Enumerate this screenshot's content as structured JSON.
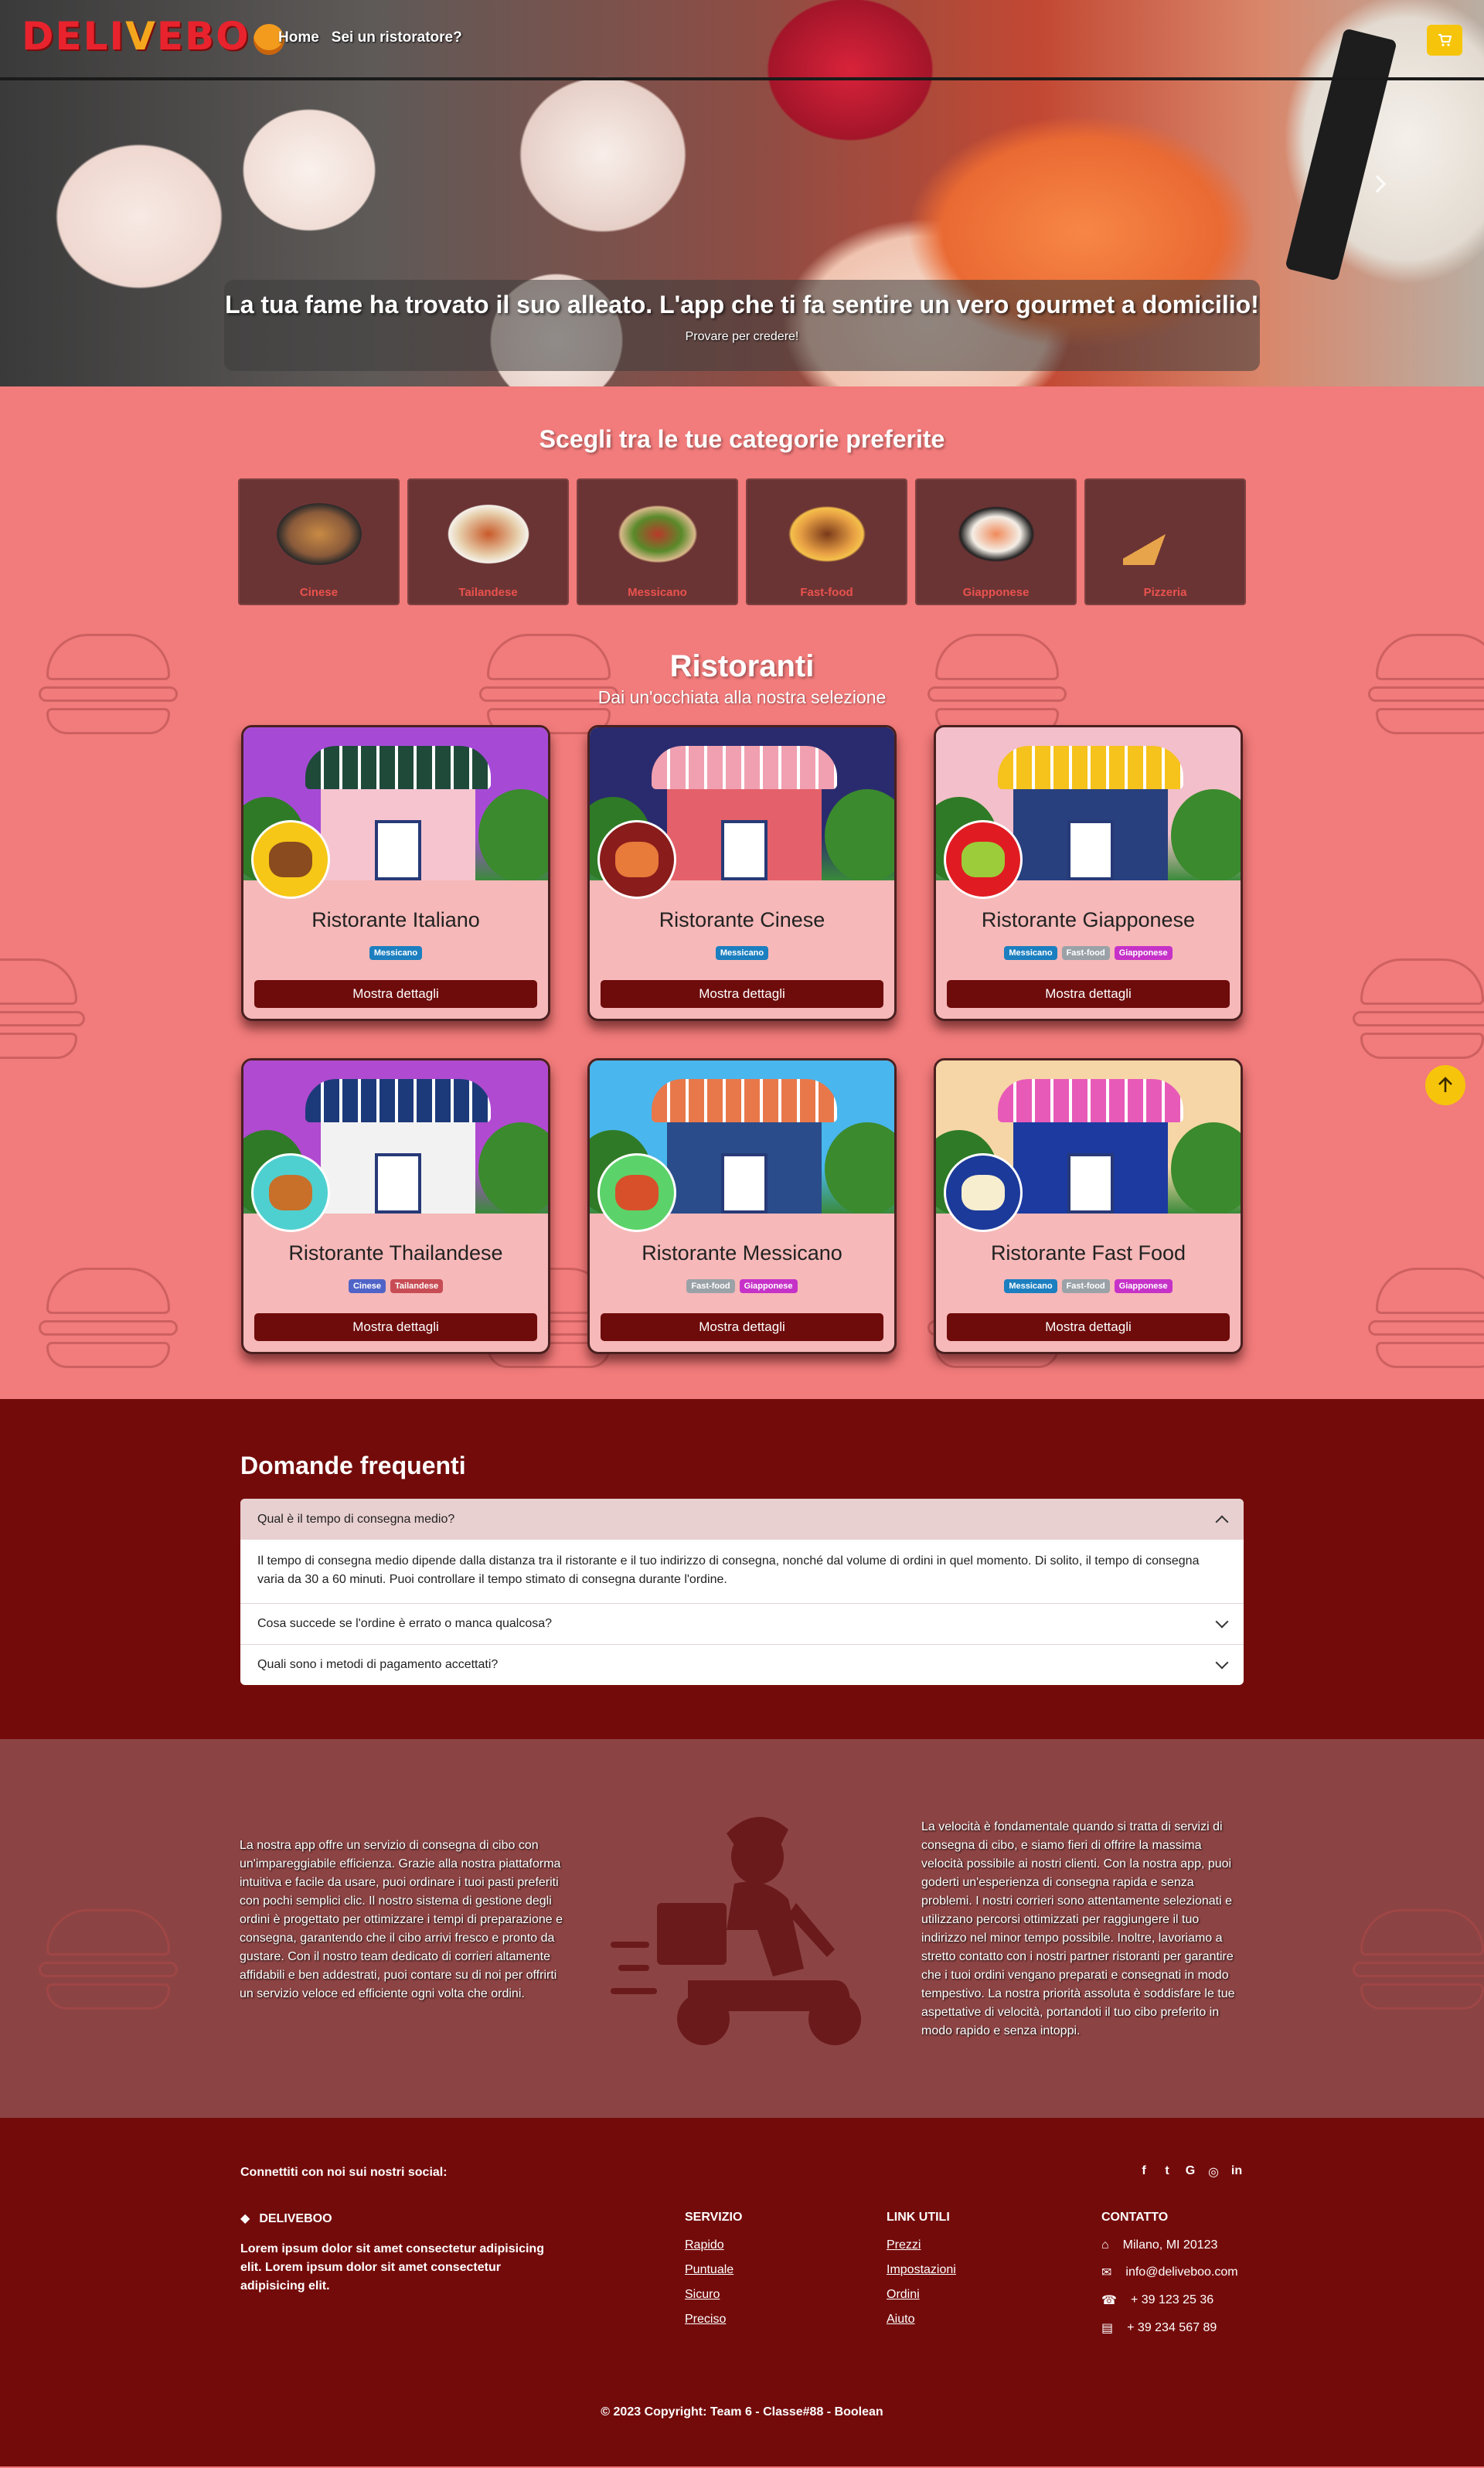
{
  "navbar": {
    "logo_text": "DELI",
    "logo_pizza": "V",
    "logo_tail": "EBO",
    "links": [
      "Home",
      "Sei un ristoratore?"
    ],
    "cart_icon": "cart-icon"
  },
  "hero": {
    "title": "La tua fame ha trovato il suo alleato. L'app che ti fa sentire un vero gourmet a domicilio!",
    "subtitle": "Provare per credere!"
  },
  "categories": {
    "title": "Scegli tra le tue categorie preferite",
    "items": [
      {
        "label": "Cinese",
        "color": "#8a5a3a"
      },
      {
        "label": "Tailandese",
        "color": "#c88a44"
      },
      {
        "label": "Messicano",
        "color": "#7a6a2a"
      },
      {
        "label": "Fast-food",
        "color": "#b66a26"
      },
      {
        "label": "Giapponese",
        "color": "#e8e2d8"
      },
      {
        "label": "Pizzeria",
        "color": "#e8a44a"
      }
    ]
  },
  "restaurants": {
    "title": "Ristoranti",
    "subtitle": "Dai un'occhiata alla nostra selezione",
    "button_label": "Mostra dettagli",
    "items": [
      {
        "name": "Ristorante Italiano",
        "tags": [
          "Messicano"
        ],
        "sky": "#a64ad6",
        "building": "#f6c4cf",
        "awning": "#1f4a3a",
        "avatar_bg": "#f6c716",
        "food": "#8a4b1e"
      },
      {
        "name": "Ristorante Cinese",
        "tags": [
          "Messicano"
        ],
        "sky": "#2a2b6e",
        "building": "#e4606a",
        "awning": "#f0a0b0",
        "avatar_bg": "#8a1c1c",
        "food": "#e87a3a"
      },
      {
        "name": "Ristorante Giapponese",
        "tags": [
          "Messicano",
          "Fast-food",
          "Giapponese"
        ],
        "sky": "#f3bfca",
        "building": "#28407e",
        "awning": "#f6c21c",
        "avatar_bg": "#e01c22",
        "food": "#9ccc3a"
      },
      {
        "name": "Ristorante Thailandese",
        "tags": [
          "Cinese",
          "Tailandese"
        ],
        "sky": "#b04ad0",
        "building": "#f2f2f2",
        "awning": "#1c3a7a",
        "avatar_bg": "#4fd0d0",
        "food": "#c8702a"
      },
      {
        "name": "Ristorante Messicano",
        "tags": [
          "Fast-food",
          "Giapponese"
        ],
        "sky": "#4ab6ee",
        "building": "#2a4c8a",
        "awning": "#e8784a",
        "avatar_bg": "#5cd26a",
        "food": "#d8502a"
      },
      {
        "name": "Ristorante Fast Food",
        "tags": [
          "Messicano",
          "Fast-food",
          "Giapponese"
        ],
        "sky": "#f6d6a6",
        "building": "#1c3aa0",
        "awning": "#e85ab8",
        "avatar_bg": "#1c3a9a",
        "food": "#f6eecf"
      }
    ]
  },
  "faq": {
    "title": "Domande frequenti",
    "items": [
      {
        "q": "Qual è il tempo di consegna medio?",
        "a": "Il tempo di consegna medio dipende dalla distanza tra il ristorante e il tuo indirizzo di consegna, nonché dal volume di ordini in quel momento. Di solito, il tempo di consegna varia da 30 a 60 minuti. Puoi controllare il tempo stimato di consegna durante l'ordine."
      },
      {
        "q": "Cosa succede se l'ordine è errato o manca qualcosa?"
      },
      {
        "q": "Quali sono i metodi di pagamento accettati?"
      }
    ]
  },
  "about": {
    "left": "La nostra app offre un servizio di consegna di cibo con un'impareggiabile efficienza. Grazie alla nostra piattaforma intuitiva e facile da usare, puoi ordinare i tuoi pasti preferiti con pochi semplici clic. Il nostro sistema di gestione degli ordini è progettato per ottimizzare i tempi di preparazione e consegna, garantendo che il cibo arrivi fresco e pronto da gustare. Con il nostro team dedicato di corrieri altamente affidabili e ben addestrati, puoi contare su di noi per offrirti un servizio veloce ed efficiente ogni volta che ordini.",
    "right": "La velocità è fondamentale quando si tratta di servizi di consegna di cibo, e siamo fieri di offrire la massima velocità possibile ai nostri clienti. Con la nostra app, puoi goderti un'esperienza di consegna rapida e senza problemi. I nostri corrieri sono attentamente selezionati e utilizzano percorsi ottimizzati per raggiungere il tuo indirizzo nel minor tempo possibile. Inoltre, lavoriamo a stretto contatto con i nostri partner ristoranti per garantire che i tuoi ordini vengano preparati e consegnati in modo tempestivo. La nostra priorità assoluta è soddisfare le tue aspettative di velocità, portandoti il tuo cibo preferito in modo rapido e senza intoppi."
  },
  "footer": {
    "social_text": "Connettiti con noi sui nostri social:",
    "social_icons": [
      "f",
      "t",
      "G",
      "◎",
      "in"
    ],
    "brand": "DELIVEBOO",
    "brand_text": "Lorem ipsum dolor sit amet consectetur adipisicing elit. Lorem ipsum dolor sit amet consectetur adipisicing elit.",
    "servizio_title": "SERVIZIO",
    "servizio": [
      "Rapido",
      "Puntuale",
      "Sicuro",
      "Preciso"
    ],
    "link_title": "LINK UTILI",
    "links": [
      "Prezzi",
      "Impostazioni",
      "Ordini",
      "Aiuto"
    ],
    "contatto_title": "CONTATTO",
    "address": "Milano, MI 20123",
    "email": "info@deliveboo.com",
    "phone": "+ 39 123 25 36",
    "fax": "+ 39 234 567 89",
    "copyright": "© 2023 Copyright: Team 6 - Classe#88 - Boolean"
  },
  "colors": {
    "accent": "#740b0b",
    "primary_bg": "#f27b7b",
    "yellow": "#f6c50b"
  }
}
